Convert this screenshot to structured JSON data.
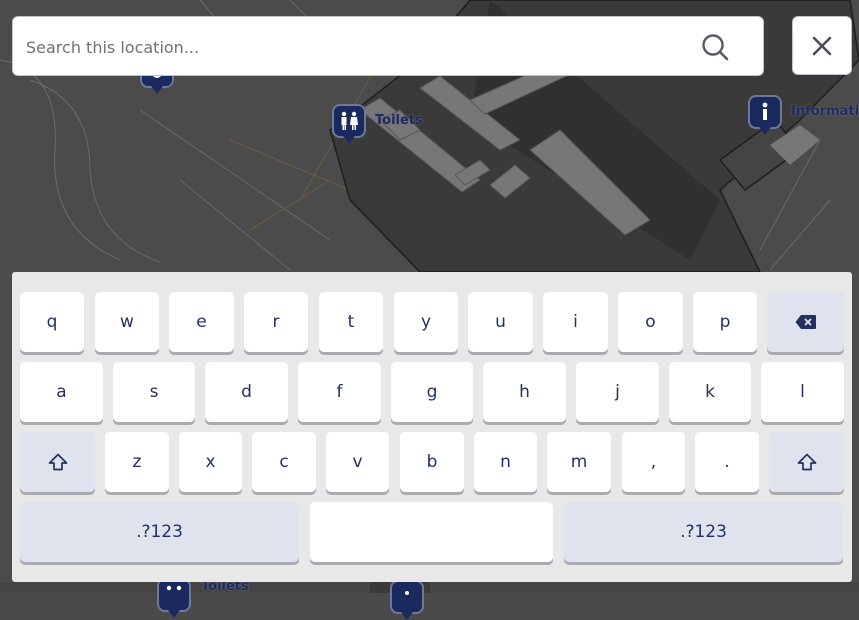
{
  "search": {
    "placeholder": "Search this location..."
  },
  "map_labels": {
    "toilets_top": "Toilets",
    "information": "Informatio",
    "toilets_bottom": "Toilets"
  },
  "keyboard": {
    "row1": [
      "q",
      "w",
      "e",
      "r",
      "t",
      "y",
      "u",
      "i",
      "o",
      "p"
    ],
    "row2": [
      "a",
      "s",
      "d",
      "f",
      "g",
      "h",
      "j",
      "k",
      "l"
    ],
    "row3": [
      "z",
      "x",
      "c",
      "v",
      "b",
      "n",
      "m",
      ",",
      "."
    ],
    "mode_left": ".?123",
    "mode_right": ".?123",
    "space": ""
  },
  "colors": {
    "brand_navy": "#1b2a5e",
    "key_text": "#243060"
  }
}
